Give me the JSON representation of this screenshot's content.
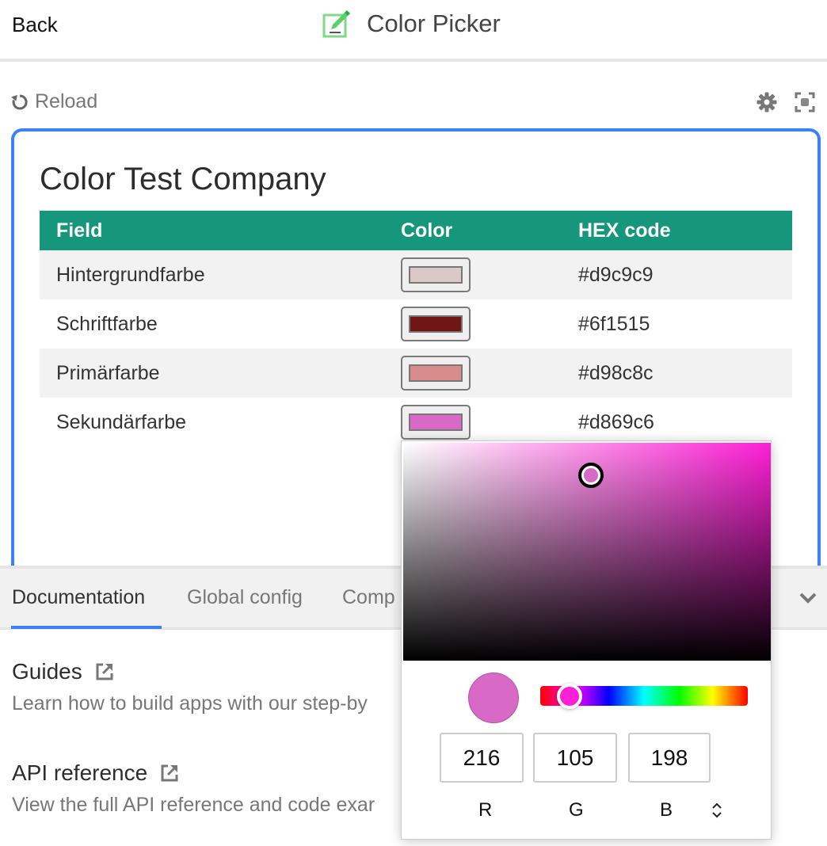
{
  "header": {
    "back_label": "Back",
    "title": "Color Picker",
    "title_icon": "edit-square-icon",
    "title_icon_color": "#4caf50"
  },
  "toolbar": {
    "reload_label": "Reload",
    "icons": [
      "reload-icon",
      "gear-icon",
      "focus-frame-icon"
    ]
  },
  "preview": {
    "accent_border": "#3b82f6",
    "heading": "Color Test Company",
    "table": {
      "header_bg": "#16967a",
      "columns": [
        "Field",
        "Color",
        "HEX code"
      ],
      "rows": [
        {
          "field": "Hintergrundfarbe",
          "color": "#d9c9c9",
          "hex": "#d9c9c9"
        },
        {
          "field": "Schriftfarbe",
          "color": "#6f1515",
          "hex": "#6f1515"
        },
        {
          "field": "Primärfarbe",
          "color": "#d98c8c",
          "hex": "#d98c8c"
        },
        {
          "field": "Sekundärfarbe",
          "color": "#d869c6",
          "hex": "#d869c6"
        }
      ]
    }
  },
  "color_picker": {
    "selected_color": "#d869c6",
    "hue_color": "#ff1fd6",
    "hue_position_fraction": 0.14,
    "saturation_fraction": 0.51,
    "value_fraction": 0.85,
    "rgb": {
      "r": "216",
      "g": "105",
      "b": "198"
    },
    "labels": {
      "r": "R",
      "g": "G",
      "b": "B"
    }
  },
  "bottom_panel": {
    "tabs": [
      {
        "label": "Documentation",
        "active": true
      },
      {
        "label": "Global config",
        "active": false
      },
      {
        "label": "Comp",
        "active": false
      }
    ],
    "items": [
      {
        "title": "Guides",
        "description": "Learn how to build apps with our step-by"
      },
      {
        "title": "API reference",
        "description": "View the full API reference and code exar"
      }
    ]
  }
}
